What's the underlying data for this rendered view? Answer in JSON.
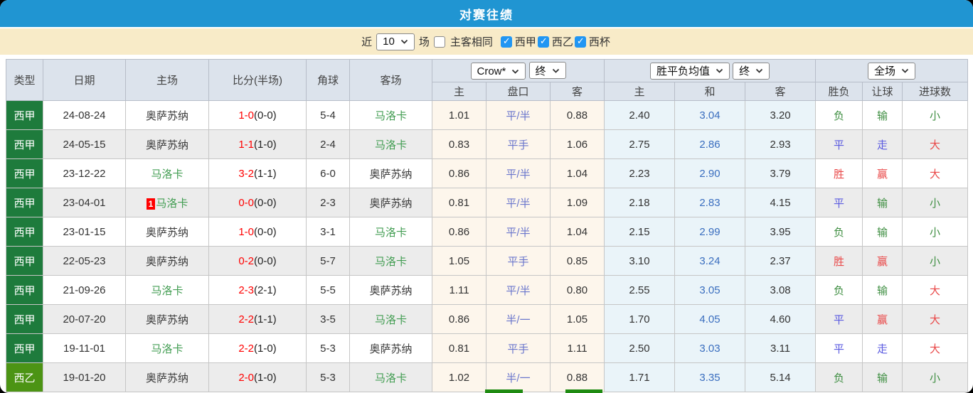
{
  "title": "对赛往绩",
  "filter": {
    "recent_label": "近",
    "count_value": "10",
    "unit_label": "场",
    "same_venue_label": "主客相同",
    "same_venue_checked": false,
    "leagues": [
      {
        "label": "西甲",
        "checked": true
      },
      {
        "label": "西乙",
        "checked": true
      },
      {
        "label": "西杯",
        "checked": true
      }
    ]
  },
  "table": {
    "columns": {
      "type": "类型",
      "date": "日期",
      "home": "主场",
      "score": "比分(半场)",
      "corners": "角球",
      "away": "客场"
    },
    "group_controls": {
      "bookmaker": "Crow*",
      "bookmaker_time": "终",
      "odds_avg": "胜平负均值",
      "odds_time": "终",
      "scope": "全场"
    },
    "sub_columns": {
      "ah_home": "主",
      "ah_line": "盘口",
      "ah_away": "客",
      "oz_home": "主",
      "oz_draw": "和",
      "oz_away": "客",
      "result": "胜负",
      "ah_result": "让球",
      "goals": "进球数"
    },
    "rows": [
      {
        "league": "西甲",
        "league_class": "jia",
        "date": "24-08-24",
        "home": "奥萨苏纳",
        "home_hl": false,
        "home_red_card": null,
        "away": "马洛卡",
        "away_hl": true,
        "away_red_card": null,
        "score_ft": "1-0",
        "score_ht": "(0-0)",
        "corners": "5-4",
        "ah_home": "1.01",
        "ah_line": "平/半",
        "ah_away": "0.88",
        "oz_home": "2.40",
        "oz_draw": "3.04",
        "oz_away": "3.20",
        "result": {
          "text": "负",
          "color": "g"
        },
        "ah_result": {
          "text": "输",
          "color": "g"
        },
        "goals": {
          "text": "小",
          "color": "g"
        }
      },
      {
        "league": "西甲",
        "league_class": "jia",
        "date": "24-05-15",
        "home": "奥萨苏纳",
        "home_hl": false,
        "home_red_card": null,
        "away": "马洛卡",
        "away_hl": true,
        "away_red_card": null,
        "score_ft": "1-1",
        "score_ht": "(1-0)",
        "corners": "2-4",
        "ah_home": "0.83",
        "ah_line": "平手",
        "ah_away": "1.06",
        "oz_home": "2.75",
        "oz_draw": "2.86",
        "oz_away": "2.93",
        "result": {
          "text": "平",
          "color": "b"
        },
        "ah_result": {
          "text": "走",
          "color": "b"
        },
        "goals": {
          "text": "大",
          "color": "r"
        }
      },
      {
        "league": "西甲",
        "league_class": "jia",
        "date": "23-12-22",
        "home": "马洛卡",
        "home_hl": true,
        "home_red_card": null,
        "away": "奥萨苏纳",
        "away_hl": false,
        "away_red_card": null,
        "score_ft": "3-2",
        "score_ht": "(1-1)",
        "corners": "6-0",
        "ah_home": "0.86",
        "ah_line": "平/半",
        "ah_away": "1.04",
        "oz_home": "2.23",
        "oz_draw": "2.90",
        "oz_away": "3.79",
        "result": {
          "text": "胜",
          "color": "r"
        },
        "ah_result": {
          "text": "赢",
          "color": "r"
        },
        "goals": {
          "text": "大",
          "color": "r"
        }
      },
      {
        "league": "西甲",
        "league_class": "jia",
        "date": "23-04-01",
        "home": "马洛卡",
        "home_hl": true,
        "home_red_card": "1",
        "away": "奥萨苏纳",
        "away_hl": false,
        "away_red_card": null,
        "score_ft": "0-0",
        "score_ht": "(0-0)",
        "corners": "2-3",
        "ah_home": "0.81",
        "ah_line": "平/半",
        "ah_away": "1.09",
        "oz_home": "2.18",
        "oz_draw": "2.83",
        "oz_away": "4.15",
        "result": {
          "text": "平",
          "color": "b"
        },
        "ah_result": {
          "text": "输",
          "color": "g"
        },
        "goals": {
          "text": "小",
          "color": "g"
        }
      },
      {
        "league": "西甲",
        "league_class": "jia",
        "date": "23-01-15",
        "home": "奥萨苏纳",
        "home_hl": false,
        "home_red_card": null,
        "away": "马洛卡",
        "away_hl": true,
        "away_red_card": null,
        "score_ft": "1-0",
        "score_ht": "(0-0)",
        "corners": "3-1",
        "ah_home": "0.86",
        "ah_line": "平/半",
        "ah_away": "1.04",
        "oz_home": "2.15",
        "oz_draw": "2.99",
        "oz_away": "3.95",
        "result": {
          "text": "负",
          "color": "g"
        },
        "ah_result": {
          "text": "输",
          "color": "g"
        },
        "goals": {
          "text": "小",
          "color": "g"
        }
      },
      {
        "league": "西甲",
        "league_class": "jia",
        "date": "22-05-23",
        "home": "奥萨苏纳",
        "home_hl": false,
        "home_red_card": null,
        "away": "马洛卡",
        "away_hl": true,
        "away_red_card": null,
        "score_ft": "0-2",
        "score_ht": "(0-0)",
        "corners": "5-7",
        "ah_home": "1.05",
        "ah_line": "平手",
        "ah_away": "0.85",
        "oz_home": "3.10",
        "oz_draw": "3.24",
        "oz_away": "2.37",
        "result": {
          "text": "胜",
          "color": "r"
        },
        "ah_result": {
          "text": "赢",
          "color": "r"
        },
        "goals": {
          "text": "小",
          "color": "g"
        }
      },
      {
        "league": "西甲",
        "league_class": "jia",
        "date": "21-09-26",
        "home": "马洛卡",
        "home_hl": true,
        "home_red_card": null,
        "away": "奥萨苏纳",
        "away_hl": false,
        "away_red_card": null,
        "score_ft": "2-3",
        "score_ht": "(2-1)",
        "corners": "5-5",
        "ah_home": "1.11",
        "ah_line": "平/半",
        "ah_away": "0.80",
        "oz_home": "2.55",
        "oz_draw": "3.05",
        "oz_away": "3.08",
        "result": {
          "text": "负",
          "color": "g"
        },
        "ah_result": {
          "text": "输",
          "color": "g"
        },
        "goals": {
          "text": "大",
          "color": "r"
        }
      },
      {
        "league": "西甲",
        "league_class": "jia",
        "date": "20-07-20",
        "home": "奥萨苏纳",
        "home_hl": false,
        "home_red_card": null,
        "away": "马洛卡",
        "away_hl": true,
        "away_red_card": null,
        "score_ft": "2-2",
        "score_ht": "(1-1)",
        "corners": "3-5",
        "ah_home": "0.86",
        "ah_line": "半/一",
        "ah_away": "1.05",
        "oz_home": "1.70",
        "oz_draw": "4.05",
        "oz_away": "4.60",
        "result": {
          "text": "平",
          "color": "b"
        },
        "ah_result": {
          "text": "赢",
          "color": "r"
        },
        "goals": {
          "text": "大",
          "color": "r"
        }
      },
      {
        "league": "西甲",
        "league_class": "jia",
        "date": "19-11-01",
        "home": "马洛卡",
        "home_hl": true,
        "home_red_card": null,
        "away": "奥萨苏纳",
        "away_hl": false,
        "away_red_card": null,
        "score_ft": "2-2",
        "score_ht": "(1-0)",
        "corners": "5-3",
        "ah_home": "0.81",
        "ah_line": "平手",
        "ah_away": "1.11",
        "oz_home": "2.50",
        "oz_draw": "3.03",
        "oz_away": "3.11",
        "result": {
          "text": "平",
          "color": "b"
        },
        "ah_result": {
          "text": "走",
          "color": "b"
        },
        "goals": {
          "text": "大",
          "color": "r"
        }
      },
      {
        "league": "西乙",
        "league_class": "yi",
        "date": "19-01-20",
        "home": "奥萨苏纳",
        "home_hl": false,
        "home_red_card": null,
        "away": "马洛卡",
        "away_hl": true,
        "away_red_card": null,
        "score_ft": "2-0",
        "score_ht": "(1-0)",
        "corners": "5-3",
        "ah_home": "1.02",
        "ah_line": "半/一",
        "ah_away": "0.88",
        "oz_home": "1.71",
        "oz_draw": "3.35",
        "oz_away": "5.14",
        "result": {
          "text": "负",
          "color": "g"
        },
        "ah_result": {
          "text": "输",
          "color": "g"
        },
        "goals": {
          "text": "小",
          "color": "g"
        }
      }
    ]
  },
  "colors": {
    "title_bar_blue": "#2095D2",
    "filter_bar_cream": "#F8EBC8",
    "header_bg": "#DCE3EC",
    "laliga_green": "#1E7B3C",
    "segunda_green": "#4C9414",
    "win_red": "#E94848",
    "draw_blue": "#5B5BE0",
    "lose_green": "#3E8E41",
    "score_red": "#FF0000",
    "highlight_team_green": "#429D52",
    "handicap_line_purple": "#6A76CC",
    "odds_draw_blue": "#3A6EBF",
    "checkbox_blue": "#2196F3",
    "summary_bar_green": "#1F8B12"
  }
}
